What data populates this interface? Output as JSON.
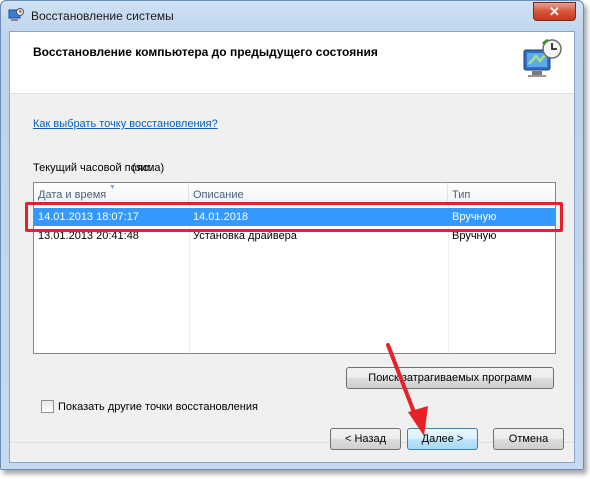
{
  "window": {
    "title": "Восстановление системы",
    "close_glyph": "✕"
  },
  "header": {
    "title": "Восстановление компьютера до предыдущего состояния",
    "icon": "system-restore-icon"
  },
  "link": {
    "text": "Как выбрать точку восстановления?"
  },
  "timezone": {
    "label": "Текущий часовой пояс:",
    "value": "(зима)"
  },
  "table": {
    "columns": [
      "Дата и время",
      "Описание",
      "Тип"
    ],
    "rows": [
      {
        "date": "14.01.2013 18:07:17",
        "description": "14.01.2018",
        "type": "Вручную",
        "selected": true
      },
      {
        "date": "13.01.2013 20:41:48",
        "description": "Установка драйвера",
        "type": "Вручную",
        "selected": false
      }
    ]
  },
  "show_more": {
    "label": "Показать другие точки восстановления",
    "checked": false
  },
  "buttons": {
    "scan": "Поиск затрагиваемых программ",
    "back": "< Назад",
    "next": "Далее >",
    "cancel": "Отмена"
  },
  "colors": {
    "selection": "#3399ff",
    "highlight": "#e8202a",
    "link": "#0b5fb7"
  }
}
